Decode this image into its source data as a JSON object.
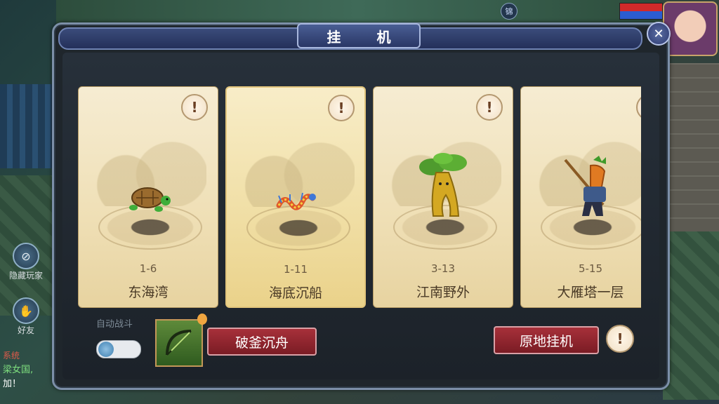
{
  "window": {
    "title": "挂 机"
  },
  "top": {
    "map_badge": "锦"
  },
  "side": {
    "hide_players": "隐藏玩家",
    "friends": "好友",
    "chat_tag": "系统",
    "chat_line1": "梁女国,",
    "chat_line2": "加！"
  },
  "cards": [
    {
      "level": "1-6",
      "name": "东海湾",
      "creature_icon": "turtle-icon",
      "selected": false
    },
    {
      "level": "1-11",
      "name": "海底沉船",
      "creature_icon": "seahorse-dragon-icon",
      "selected": true
    },
    {
      "level": "3-13",
      "name": "江南野外",
      "creature_icon": "tree-demon-icon",
      "selected": false
    },
    {
      "level": "5-15",
      "name": "大雁塔一层",
      "creature_icon": "carrot-warrior-icon",
      "selected": false
    }
  ],
  "controls": {
    "auto_battle_label": "自动战斗",
    "auto_battle_on": false,
    "skill_button_label": "破釜沉舟",
    "idle_here_label": "原地挂机"
  },
  "colors": {
    "button_red": "#8f2630",
    "card_bg": "#efdfb5",
    "panel_border": "#7c8fa8"
  }
}
